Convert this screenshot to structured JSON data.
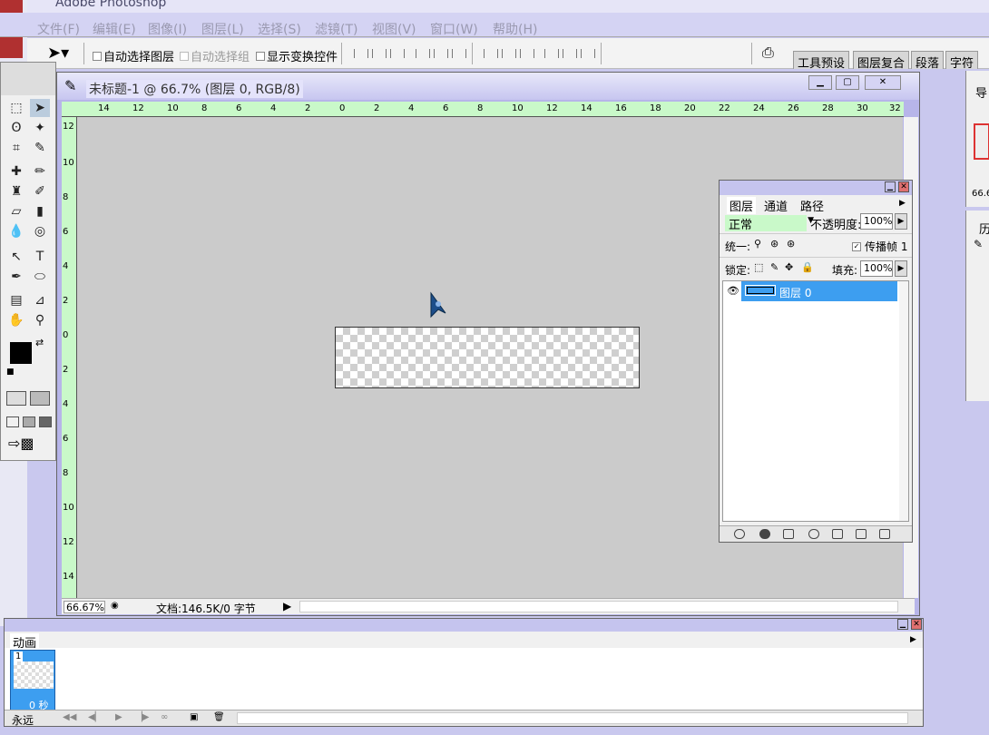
{
  "app": {
    "title": "Adobe Photoshop"
  },
  "menu": [
    "文件(F)",
    "编辑(E)",
    "图像(I)",
    "图层(L)",
    "选择(S)",
    "滤镜(T)",
    "视图(V)",
    "窗口(W)",
    "帮助(H)"
  ],
  "options": {
    "auto_select_layer": "自动选择图层",
    "auto_select_group": "自动选择组",
    "show_transform": "显示变换控件"
  },
  "palette_well": [
    "工具预设",
    "图层复合",
    "段落",
    "字符"
  ],
  "document": {
    "title": "未标题-1 @ 66.7% (图层 0, RGB/8)",
    "zoom": "66.67%",
    "doc_info": "文档:146.5K/0 字节",
    "h_ruler": [
      "14",
      "12",
      "10",
      "8",
      "6",
      "4",
      "2",
      "0",
      "2",
      "4",
      "6",
      "8",
      "10",
      "12",
      "14",
      "16",
      "18",
      "20",
      "22",
      "24",
      "26",
      "28",
      "30",
      "32"
    ],
    "v_ruler": [
      "12",
      "10",
      "8",
      "6",
      "4",
      "2",
      "0",
      "2",
      "4",
      "6",
      "8",
      "10",
      "12",
      "14"
    ]
  },
  "layers_panel": {
    "tabs": [
      "图层",
      "通道",
      "路径"
    ],
    "blend_mode": "正常",
    "opacity_label": "不透明度:",
    "opacity": "100%",
    "unify_label": "统一:",
    "propagate_label": "传播帧 1",
    "lock_label": "锁定:",
    "fill_label": "填充:",
    "fill": "100%",
    "layer_name": "图层 0"
  },
  "side_panels": {
    "navigator_tab": "导",
    "navigator_zoom": "66.6",
    "history_tab": "历"
  },
  "animation": {
    "title": "动画",
    "frame_number": "1",
    "frame_delay": "0 秒",
    "loop": "永远"
  }
}
